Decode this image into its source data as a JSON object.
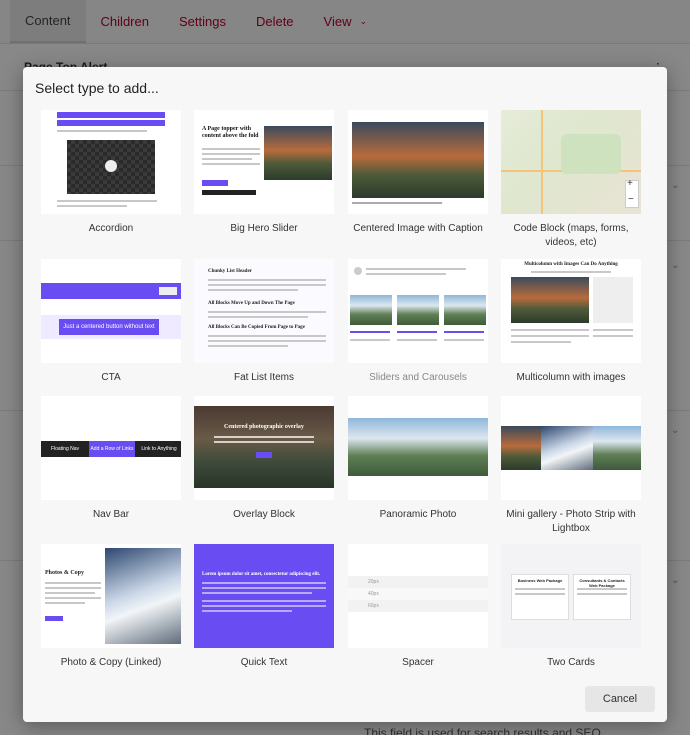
{
  "tabs": [
    {
      "label": "Content"
    },
    {
      "label": "Children"
    },
    {
      "label": "Settings"
    },
    {
      "label": "Delete"
    },
    {
      "label": "View"
    }
  ],
  "background": {
    "section_title": "Page Top Alert",
    "footer_hint": "This field is used for search results and SEO"
  },
  "modal": {
    "title": "Select type to add...",
    "cancel_label": "Cancel",
    "items": [
      {
        "label": "Accordion"
      },
      {
        "label": "Big Hero Slider"
      },
      {
        "label": "Centered Image with Caption"
      },
      {
        "label": "Code Block (maps, forms, videos, etc)"
      },
      {
        "label": "CTA"
      },
      {
        "label": "Fat List Items"
      },
      {
        "label": "Sliders and Carousels"
      },
      {
        "label": "Multicolumn with images"
      },
      {
        "label": "Nav Bar"
      },
      {
        "label": "Overlay Block"
      },
      {
        "label": "Panoramic Photo"
      },
      {
        "label": "Mini gallery - Photo Strip with Lightbox"
      },
      {
        "label": "Photo & Copy (Linked)"
      },
      {
        "label": "Quick Text"
      },
      {
        "label": "Spacer"
      },
      {
        "label": "Two Cards"
      }
    ],
    "thumb_text": {
      "hero_heading": "A Page topper with content above the fold",
      "cta_button": "Just a centered button without text",
      "fat_list_header": "Chunky List Header",
      "fat_list_1": "All Blocks Move Up and Down The Page",
      "fat_list_2": "All Blocks Can Be Copied From Page to Page",
      "multicol_title": "Multicolumn with Images Can Do Anything",
      "nav_1": "Floating Nav",
      "nav_2": "Add a Row of Links",
      "nav_3": "Link to Anything",
      "overlay_title": "Centered photographic overlay",
      "photo_copy_title": "Photos & Copy",
      "quick_text_title": "Lorem ipsum dolor sit amet, consectetur adipiscing elit.",
      "spacer_1": "20px",
      "spacer_2": "40px",
      "spacer_3": "60px",
      "two_cards_1": "Business Web Package",
      "two_cards_2": "Consultants & Contacts Web Package"
    }
  },
  "colors": {
    "accent": "#6a4df2",
    "tab_link": "#b3002d"
  }
}
